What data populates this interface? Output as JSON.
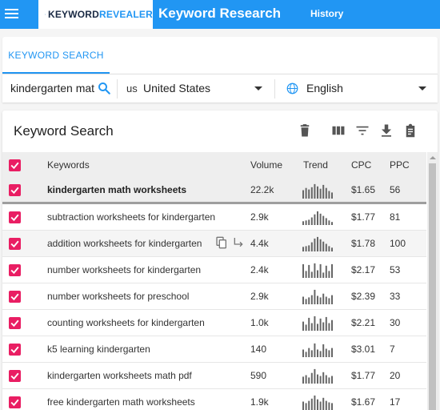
{
  "header": {
    "logo_text_1": "KEYWORD",
    "logo_text_2": "REVEALER",
    "title": "Keyword Research",
    "nav_history": "History"
  },
  "tabs": {
    "active": "KEYWORD SEARCH"
  },
  "search": {
    "keyword_value": "kindergarten mat",
    "country_code": "us",
    "country": "United States",
    "language": "English"
  },
  "results": {
    "title": "Keyword Search",
    "columns": {
      "keywords": "Keywords",
      "volume": "Volume",
      "trend": "Trend",
      "cpc": "CPC",
      "ppc": "PPC"
    },
    "rows": [
      {
        "keyword": "kindergarten math worksheets",
        "volume": "22.2k",
        "cpc": "$1.65",
        "ppc": "56",
        "trend": [
          0.55,
          0.7,
          0.6,
          0.75,
          0.95,
          0.8,
          0.65,
          0.9,
          0.7,
          0.5,
          0.4
        ]
      },
      {
        "keyword": "subtraction worksheets for kindergarten",
        "volume": "2.9k",
        "cpc": "$1.77",
        "ppc": "81",
        "trend": [
          0.25,
          0.3,
          0.35,
          0.5,
          0.7,
          0.9,
          0.75,
          0.6,
          0.45,
          0.3,
          0.2
        ]
      },
      {
        "keyword": "addition worksheets for kindergarten",
        "volume": "4.4k",
        "cpc": "$1.78",
        "ppc": "100",
        "trend": [
          0.3,
          0.35,
          0.4,
          0.6,
          0.85,
          0.95,
          0.8,
          0.65,
          0.5,
          0.35,
          0.25
        ]
      },
      {
        "keyword": "number worksheets for kindergarten",
        "volume": "2.4k",
        "cpc": "$2.17",
        "ppc": "53",
        "trend": [
          0.9,
          0.45,
          0.85,
          0.4,
          0.95,
          0.5,
          0.9,
          0.35,
          0.8,
          0.45,
          0.9
        ]
      },
      {
        "keyword": "number worksheets for preschool",
        "volume": "2.9k",
        "cpc": "$2.39",
        "ppc": "33",
        "trend": [
          0.5,
          0.35,
          0.45,
          0.6,
          0.95,
          0.55,
          0.45,
          0.7,
          0.5,
          0.4,
          0.6
        ]
      },
      {
        "keyword": "counting worksheets for kindergarten",
        "volume": "1.0k",
        "cpc": "$2.21",
        "ppc": "30",
        "trend": [
          0.6,
          0.4,
          0.85,
          0.5,
          0.95,
          0.45,
          0.8,
          0.55,
          0.9,
          0.5,
          0.7
        ]
      },
      {
        "keyword": "k5 learning kindergarten",
        "volume": "140",
        "cpc": "$3.01",
        "ppc": "7",
        "trend": [
          0.5,
          0.35,
          0.6,
          0.45,
          0.9,
          0.5,
          0.4,
          0.85,
          0.55,
          0.45,
          0.6
        ]
      },
      {
        "keyword": "kindergarten worksheets math pdf",
        "volume": "590",
        "cpc": "$1.77",
        "ppc": "20",
        "trend": [
          0.45,
          0.55,
          0.4,
          0.7,
          0.95,
          0.6,
          0.5,
          0.75,
          0.55,
          0.4,
          0.5
        ]
      },
      {
        "keyword": "free kindergarten math worksheets",
        "volume": "1.9k",
        "cpc": "$1.67",
        "ppc": "17",
        "trend": [
          0.55,
          0.45,
          0.6,
          0.75,
          0.95,
          0.7,
          0.55,
          0.8,
          0.6,
          0.5,
          0.45
        ]
      }
    ]
  },
  "icons": [
    "menu-icon",
    "search-icon",
    "globe-icon",
    "delete-icon",
    "columns-icon",
    "filter-icon",
    "download-icon",
    "clipboard-icon",
    "copy-icon",
    "subdirectory-arrow-icon"
  ],
  "colors": {
    "primary": "#2196f3",
    "checkbox": "#e91e63",
    "trend_bar": "#666666"
  }
}
